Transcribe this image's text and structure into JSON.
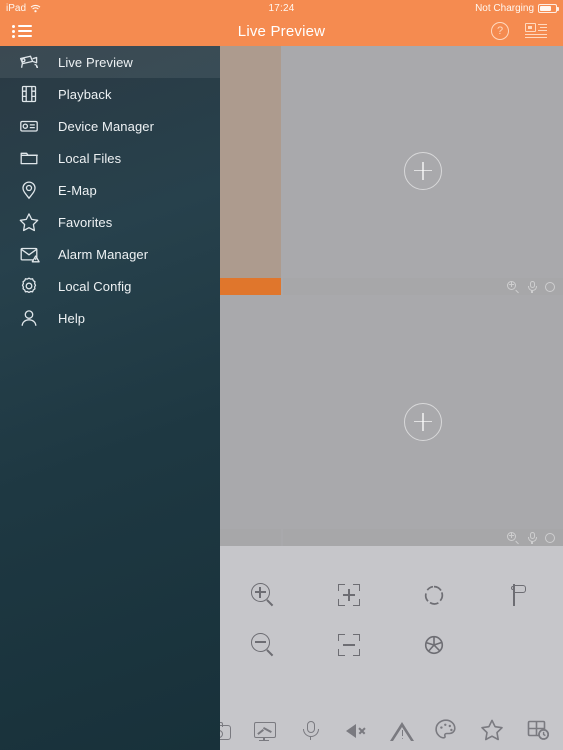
{
  "status_bar": {
    "device": "iPad",
    "wifi_icon": "wifi-icon",
    "time": "17:24",
    "battery_text": "Not Charging",
    "battery_icon": "battery-icon"
  },
  "nav_bar": {
    "menu_icon": "list-menu-icon",
    "title": "Live Preview",
    "help_icon": "help-circle-icon",
    "help_label": "?",
    "device_list_icon": "device-list-icon"
  },
  "sidebar": {
    "items": [
      {
        "label": "Live Preview",
        "icon": "camera-ptz-icon",
        "active": true
      },
      {
        "label": "Playback",
        "icon": "film-strip-icon",
        "active": false
      },
      {
        "label": "Device Manager",
        "icon": "dvr-device-icon",
        "active": false
      },
      {
        "label": "Local Files",
        "icon": "folder-icon",
        "active": false
      },
      {
        "label": "E-Map",
        "icon": "map-pin-icon",
        "active": false
      },
      {
        "label": "Favorites",
        "icon": "star-icon",
        "active": false
      },
      {
        "label": "Alarm Manager",
        "icon": "alarm-envelope-icon",
        "active": false
      },
      {
        "label": "Local Config",
        "icon": "gear-icon",
        "active": false
      },
      {
        "label": "Help",
        "icon": "user-icon",
        "active": false
      }
    ]
  },
  "video_grid": {
    "rows": 2,
    "columns": 2,
    "cells": [
      {
        "name": "video-cell-1",
        "selected": true,
        "has_stream": false,
        "add_icon": "plus-circle-icon",
        "toolbar": {
          "active": true,
          "icons": [
            "digital-zoom-icon",
            "microphone-icon",
            "record-icon"
          ],
          "align": "left"
        }
      },
      {
        "name": "video-cell-2",
        "selected": false,
        "has_stream": false,
        "add_icon": "plus-circle-icon",
        "toolbar": {
          "active": false,
          "icons": [
            "digital-zoom-icon",
            "microphone-icon",
            "record-icon"
          ],
          "align": "right"
        }
      },
      {
        "name": "video-cell-3",
        "selected": false,
        "has_stream": false,
        "add_icon": "plus-circle-icon",
        "toolbar": {
          "active": false,
          "icons": [
            "digital-zoom-icon",
            "microphone-icon",
            "record-icon"
          ],
          "align": "left"
        }
      },
      {
        "name": "video-cell-4",
        "selected": false,
        "has_stream": false,
        "add_icon": "plus-circle-icon",
        "toolbar": {
          "active": false,
          "icons": [
            "digital-zoom-icon",
            "microphone-icon",
            "record-icon"
          ],
          "align": "right"
        }
      }
    ]
  },
  "ptz_panel": {
    "buttons": [
      {
        "name": "ptz-zoom-in",
        "icon": "magnifier-plus-icon"
      },
      {
        "name": "ptz-focus-near",
        "icon": "focus-plus-icon"
      },
      {
        "name": "ptz-iris-open",
        "icon": "iris-open-icon"
      },
      {
        "name": "ptz-preset",
        "icon": "flag-icon"
      },
      {
        "name": "ptz-zoom-out",
        "icon": "magnifier-minus-icon"
      },
      {
        "name": "ptz-focus-far",
        "icon": "focus-minus-icon"
      },
      {
        "name": "ptz-iris-close",
        "icon": "iris-close-icon"
      }
    ]
  },
  "tab_bar": {
    "items": [
      {
        "name": "tab-snapshot",
        "icon": "camera-icon"
      },
      {
        "name": "tab-record",
        "icon": "monitor-record-icon"
      },
      {
        "name": "tab-talk",
        "icon": "microphone-icon"
      },
      {
        "name": "tab-audio-mute",
        "icon": "speaker-mute-icon"
      },
      {
        "name": "tab-alarm",
        "icon": "warning-triangle-icon"
      },
      {
        "name": "tab-image-color",
        "icon": "palette-icon"
      },
      {
        "name": "tab-favorites",
        "icon": "star-icon"
      },
      {
        "name": "tab-layout",
        "icon": "grid-clock-icon"
      }
    ]
  },
  "colors": {
    "accent_orange": "#f58b50",
    "toolbar_active_orange": "#e0762c",
    "sidebar_dark": "#1e3842",
    "panel_gray": "#c6c6ca",
    "video_gray": "#a9a9ac",
    "cell_selected": "#ad9b8e"
  }
}
